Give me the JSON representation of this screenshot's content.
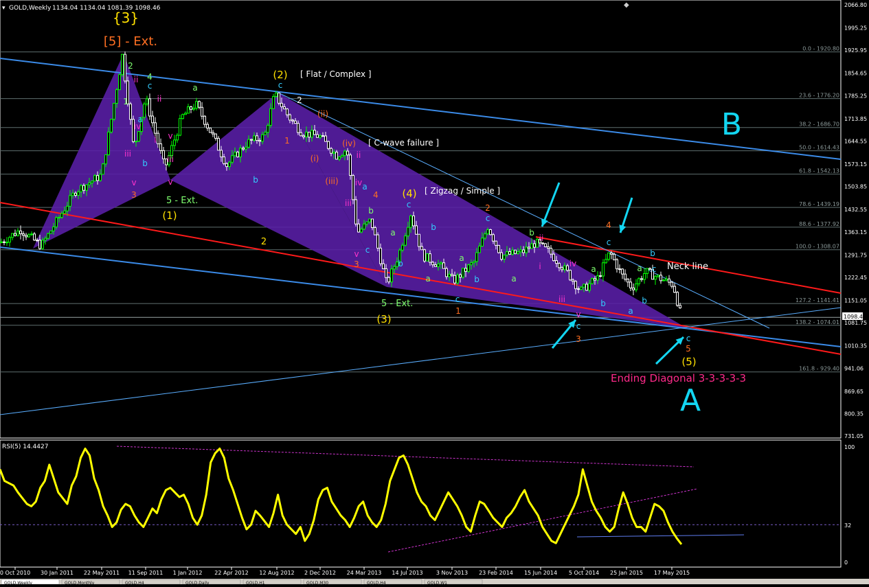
{
  "header": {
    "symbol": "GOLD,Weekly",
    "ohlc": "1134.04 1134.04 1081.39 1098.46"
  },
  "rsi_header": "RSI(5) 14.4427",
  "last_price_tag": "1098.46",
  "bottom_tabs": [
    "GOLD,Weekly",
    "GOLD,Monthly",
    "GOLD,H4",
    "GOLD,Daily",
    "GOLD,H1",
    "GOLD,M30",
    "GOLD,H4",
    "GOLD,W1"
  ],
  "colors": {
    "background": "#000000",
    "bull_candle": "#00ff00",
    "bear_candle": "#ffffff",
    "channel": "#3b8be8",
    "red_line": "#ff1a1a",
    "thin_line": "#5aaeff",
    "triangle": "#5a1fa8",
    "rsi": "#ffff00",
    "rsi_guide": "#cc33cc",
    "fib": "#5f6f6f",
    "arrows": "#13d6f2",
    "ending_diagonal": "#ff2a8a",
    "wave_yellow": "#ffe000",
    "wave_orange": "#ff6f22",
    "wave_green": "#7fff6f"
  },
  "chart_data": [
    {
      "type": "line",
      "title": "",
      "series": [
        {
          "name": "GOLD,Weekly"
        }
      ],
      "x_ticks": [
        "0 Oct 2010",
        "30 Jan 2011",
        "22 May 2011",
        "11 Sep 2011",
        "1 Jan 2012",
        "22 Apr 2012",
        "12 Aug 2012",
        "2 Dec 2012",
        "24 Mar 2013",
        "14 Jul 2013",
        "3 Nov 2013",
        "23 Feb 2014",
        "15 Jun 2014",
        "5 Oct 2014",
        "25 Jan 2015",
        "17 May 2015"
      ],
      "y_ticks": [
        "2066.80",
        "1995.25",
        "1925.95",
        "1854.65",
        "1785.25",
        "1713.85",
        "1644.55",
        "1573.15",
        "1503.85",
        "1432.55",
        "1363.15",
        "1291.75",
        "1222.45",
        "1151.05",
        "1081.75",
        "1010.35",
        "941.06",
        "869.65",
        "800.35",
        "731.05"
      ],
      "ylim": [
        731.05,
        2066.8
      ],
      "fib_levels": [
        {
          "label": "0.0 - 1920.80",
          "value": 1920.8
        },
        {
          "label": "23.6 - 1776.20",
          "value": 1776.2
        },
        {
          "label": "38.2 - 1686.70",
          "value": 1686.7
        },
        {
          "label": "50.0 - 1614.43",
          "value": 1614.43
        },
        {
          "label": "61.8 - 1542.13",
          "value": 1542.13
        },
        {
          "label": "78.6 - 1439.19",
          "value": 1439.19
        },
        {
          "label": "88.6 - 1377.92",
          "value": 1377.92
        },
        {
          "label": "100.0 - 1308.07",
          "value": 1308.07
        },
        {
          "label": "127.2 - 1141.41",
          "value": 1141.41
        },
        {
          "label": "138.2 - 1074.01",
          "value": 1074.01
        },
        {
          "label": "161.8 - 929.40",
          "value": 929.4
        }
      ],
      "price_path": [
        {
          "x": "0 Oct 2010",
          "y": 1330
        },
        {
          "x": "30 Jan 2011",
          "y": 1370
        },
        {
          "x": "22 May 2011",
          "y": 1500
        },
        {
          "x": "11 Sep 2011",
          "y": 1900
        },
        {
          "x": "1 Jan 2012",
          "y": 1590
        },
        {
          "x": "22 Apr 2012",
          "y": 1640
        },
        {
          "x": "12 Aug 2012",
          "y": 1780
        },
        {
          "x": "2 Dec 2012",
          "y": 1660
        },
        {
          "x": "24 Mar 2013",
          "y": 1580
        },
        {
          "x": "14 Jul 2013",
          "y": 1250
        },
        {
          "x": "3 Nov 2013",
          "y": 1310
        },
        {
          "x": "23 Feb 2014",
          "y": 1330
        },
        {
          "x": "15 Jun 2014",
          "y": 1310
        },
        {
          "x": "5 Oct 2014",
          "y": 1190
        },
        {
          "x": "25 Jan 2015",
          "y": 1290
        },
        {
          "x": "17 May 2015",
          "y": 1200
        },
        {
          "x": "17 May 2015",
          "y": 1098.46
        }
      ],
      "annotations": [
        {
          "text": "{3}",
          "color": "yellow"
        },
        {
          "text": "[5] - Ext.",
          "color": "orange"
        },
        {
          "text": "(2)",
          "color": "yellow"
        },
        {
          "text": "[ Flat / Complex ]",
          "color": "white"
        },
        {
          "text": "[ C-wave failure ]",
          "color": "white"
        },
        {
          "text": "[ Zigzag / Simple ]",
          "color": "white"
        },
        {
          "text": "(4)",
          "color": "yellow"
        },
        {
          "text": "(1)",
          "color": "yellow"
        },
        {
          "text": "5 - Ext.",
          "color": "green"
        },
        {
          "text": "(3)",
          "color": "yellow"
        },
        {
          "text": "(5)",
          "color": "yellow"
        },
        {
          "text": "Neck line",
          "color": "white"
        },
        {
          "text": "Ending Diagonal 3-3-3-3-3",
          "color": "pink"
        }
      ],
      "greek_labels": [
        "B",
        "A"
      ]
    },
    {
      "type": "line",
      "title": "RSI(5) 14.4427",
      "series": [
        {
          "name": "RSI(5)"
        }
      ],
      "ylim": [
        0,
        100
      ],
      "y_ticks": [
        "100",
        "32",
        "0"
      ],
      "rsi_values": [
        80,
        70,
        68,
        66,
        60,
        55,
        50,
        48,
        52,
        64,
        70,
        84,
        72,
        60,
        55,
        50,
        66,
        74,
        90,
        98,
        92,
        72,
        62,
        48,
        40,
        30,
        34,
        45,
        50,
        48,
        40,
        34,
        30,
        38,
        46,
        42,
        54,
        62,
        64,
        60,
        56,
        58,
        50,
        38,
        32,
        40,
        58,
        86,
        94,
        98,
        90,
        72,
        62,
        50,
        38,
        28,
        32,
        44,
        40,
        35,
        30,
        42,
        58,
        40,
        32,
        28,
        24,
        30,
        18,
        24,
        36,
        54,
        62,
        64,
        52,
        46,
        40,
        36,
        30,
        38,
        48,
        52,
        40,
        34,
        30,
        36,
        50,
        70,
        80,
        90,
        92,
        84,
        72,
        60,
        52,
        48,
        40,
        36,
        44,
        52,
        60,
        54,
        48,
        40,
        30,
        26,
        40,
        52,
        50,
        44,
        38,
        34,
        30,
        38,
        42,
        48,
        56,
        62,
        52,
        46,
        40,
        30,
        24,
        18,
        16,
        24,
        32,
        40,
        48,
        58,
        80,
        66,
        52,
        44,
        38,
        30,
        26,
        30,
        46,
        60,
        50,
        38,
        30,
        30,
        26,
        38,
        50,
        48,
        44,
        34,
        26,
        20,
        15
      ]
    }
  ]
}
